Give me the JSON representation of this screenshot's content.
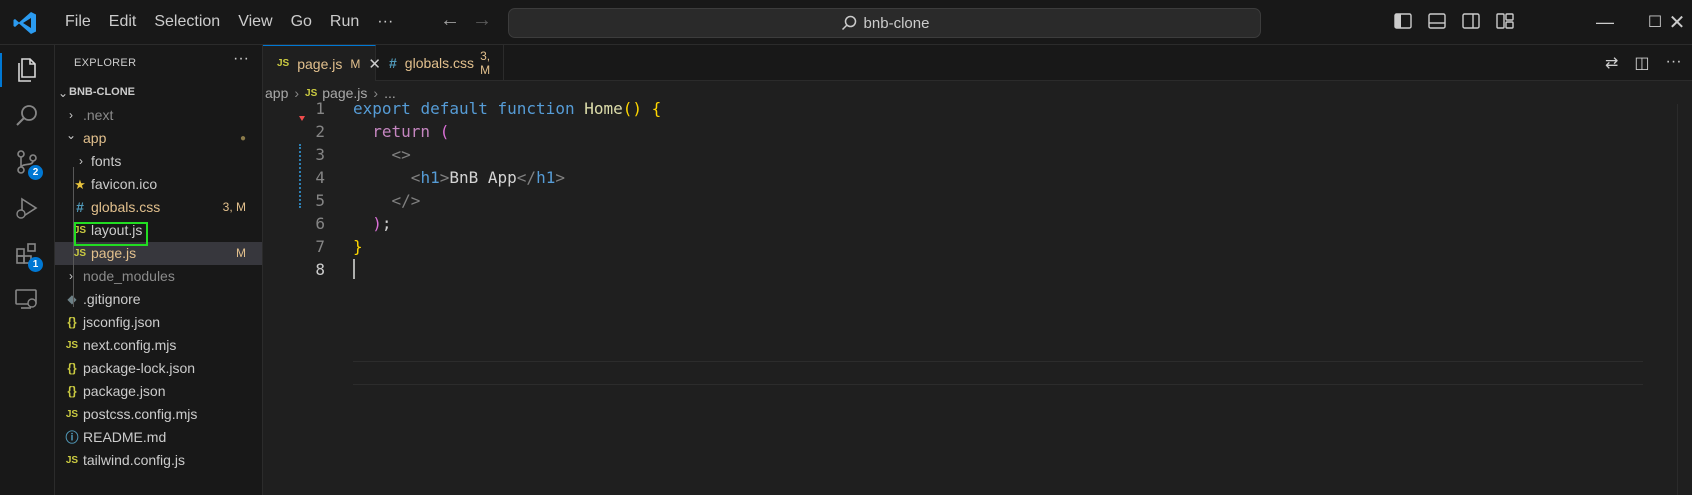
{
  "titlebar": {
    "menu": [
      "File",
      "Edit",
      "Selection",
      "View",
      "Go",
      "Run",
      "···"
    ],
    "search_text": "bnb-clone",
    "logo_icon": "vscode-logo-icon"
  },
  "activity": {
    "source_control_badge": "2",
    "extensions_badge": "1"
  },
  "explorer": {
    "title": "EXPLORER",
    "more": "···",
    "project": "BNB-CLONE",
    "items": [
      {
        "label": ".next",
        "type": "folder",
        "status": ""
      },
      {
        "label": "app",
        "type": "folder-open",
        "status": "●"
      },
      {
        "label": "fonts",
        "type": "folder",
        "status": ""
      },
      {
        "label": "favicon.ico",
        "type": "star",
        "status": ""
      },
      {
        "label": "globals.css",
        "type": "css",
        "status": "3, M"
      },
      {
        "label": "layout.js",
        "type": "js",
        "status": ""
      },
      {
        "label": "page.js",
        "type": "js",
        "status": "M"
      },
      {
        "label": "node_modules",
        "type": "folder",
        "status": ""
      },
      {
        "label": ".gitignore",
        "type": "git",
        "status": ""
      },
      {
        "label": "jsconfig.json",
        "type": "json",
        "status": ""
      },
      {
        "label": "next.config.mjs",
        "type": "js",
        "status": ""
      },
      {
        "label": "package-lock.json",
        "type": "json",
        "status": ""
      },
      {
        "label": "package.json",
        "type": "json",
        "status": ""
      },
      {
        "label": "postcss.config.mjs",
        "type": "js",
        "status": ""
      },
      {
        "label": "README.md",
        "type": "info",
        "status": ""
      },
      {
        "label": "tailwind.config.js",
        "type": "js",
        "status": ""
      }
    ]
  },
  "tabs": [
    {
      "icon": "JS",
      "label": "page.js",
      "status": "M",
      "active": true
    },
    {
      "icon": "#",
      "label": "globals.css",
      "status": "3, M",
      "active": false
    }
  ],
  "breadcrumb": [
    "app",
    "page.js",
    "..."
  ],
  "breadcrumb_icon": "JS",
  "code": {
    "line_numbers": [
      "1",
      "2",
      "3",
      "4",
      "5",
      "6",
      "7",
      "8"
    ],
    "lines": [
      "export default function Home() {",
      "  return (",
      "    <>",
      "      <h1>BnB App</h1>",
      "    </>",
      "  );",
      "}",
      ""
    ]
  },
  "colors": {
    "accent": "#0078d4",
    "modified": "#e2c08d",
    "highlight_box": "#22dd22",
    "keyword": "#569cd6",
    "control": "#c586c0",
    "function": "#dcdcaa"
  }
}
